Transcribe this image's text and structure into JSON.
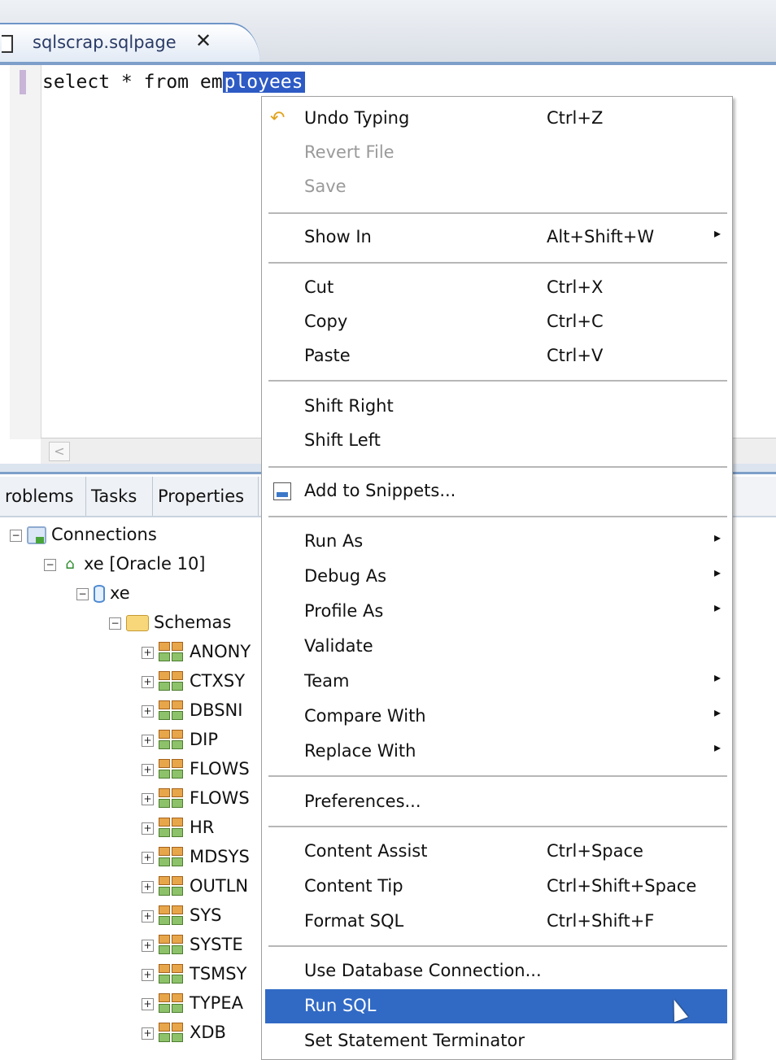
{
  "editor_tab": {
    "label": "sqlscrap.sqlpage",
    "close_glyph": "✕"
  },
  "editor": {
    "plain_text": "select * from em",
    "selected_text": "ployees"
  },
  "view_tabs": [
    "roblems",
    "Tasks",
    "Properties"
  ],
  "tree": {
    "connections": "Connections",
    "connection": "xe [Oracle 10]",
    "database": "xe",
    "schemas": "Schemas",
    "schema_items": [
      "ANONY",
      "CTXSY",
      "DBSNI",
      "DIP",
      "FLOWS",
      "FLOWS",
      "HR",
      "MDSYS",
      "OUTLN",
      "SYS",
      "SYSTE",
      "TSMSY",
      "TYPEA",
      "XDB"
    ]
  },
  "menu": {
    "undo": {
      "label": "Undo Typing",
      "shortcut": "Ctrl+Z"
    },
    "revert": {
      "label": "Revert File"
    },
    "save": {
      "label": "Save"
    },
    "show_in": {
      "label": "Show In",
      "shortcut": "Alt+Shift+W"
    },
    "cut": {
      "label": "Cut",
      "shortcut": "Ctrl+X"
    },
    "copy": {
      "label": "Copy",
      "shortcut": "Ctrl+C"
    },
    "paste": {
      "label": "Paste",
      "shortcut": "Ctrl+V"
    },
    "shift_right": {
      "label": "Shift Right"
    },
    "shift_left": {
      "label": "Shift Left"
    },
    "add_snippets": {
      "label": "Add to Snippets..."
    },
    "run_as": {
      "label": "Run As"
    },
    "debug_as": {
      "label": "Debug As"
    },
    "profile_as": {
      "label": "Profile As"
    },
    "validate": {
      "label": "Validate"
    },
    "team": {
      "label": "Team"
    },
    "compare_with": {
      "label": "Compare With"
    },
    "replace_with": {
      "label": "Replace With"
    },
    "preferences": {
      "label": "Preferences..."
    },
    "content_assist": {
      "label": "Content Assist",
      "shortcut": "Ctrl+Space"
    },
    "content_tip": {
      "label": "Content Tip",
      "shortcut": "Ctrl+Shift+Space"
    },
    "format_sql": {
      "label": "Format SQL",
      "shortcut": "Ctrl+Shift+F"
    },
    "use_db_connection": {
      "label": "Use Database Connection..."
    },
    "run_sql": {
      "label": "Run SQL"
    },
    "set_terminator": {
      "label": "Set Statement Terminator"
    },
    "submenu_arrow": "▸"
  },
  "colors": {
    "menu_highlight": "#316ac5",
    "selection": "#2d5ac4",
    "tab_accent": "#7d9fc9"
  }
}
